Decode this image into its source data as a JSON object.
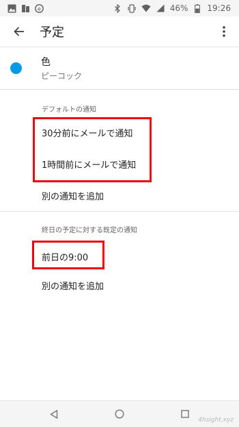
{
  "status_bar": {
    "battery": "46%",
    "time": "19:26",
    "left_icons": [
      "image-icon",
      "sd-card-icon",
      "e-badge-icon"
    ],
    "right_icons": [
      "bluetooth-icon",
      "vibrate-icon",
      "wifi-icon",
      "signal-icon",
      "battery-icon"
    ]
  },
  "app_bar": {
    "title": "予定"
  },
  "color": {
    "label": "色",
    "value": "ピーコック",
    "dot_color": "#039be5"
  },
  "default_notifications": {
    "header": "デフォルトの通知",
    "items": [
      "30分前にメールで通知",
      "1時間前にメールで通知"
    ],
    "add_label": "別の通知を追加"
  },
  "all_day_notifications": {
    "header": "終日の予定に対する既定の通知",
    "items": [
      "前日の9:00"
    ],
    "add_label": "別の通知を追加"
  },
  "navigation": {
    "buttons": [
      "back-triangle-icon",
      "home-circle-icon",
      "recents-square-icon"
    ]
  },
  "watermark": "4hsight.xyz",
  "highlight_color": "#e8000f"
}
